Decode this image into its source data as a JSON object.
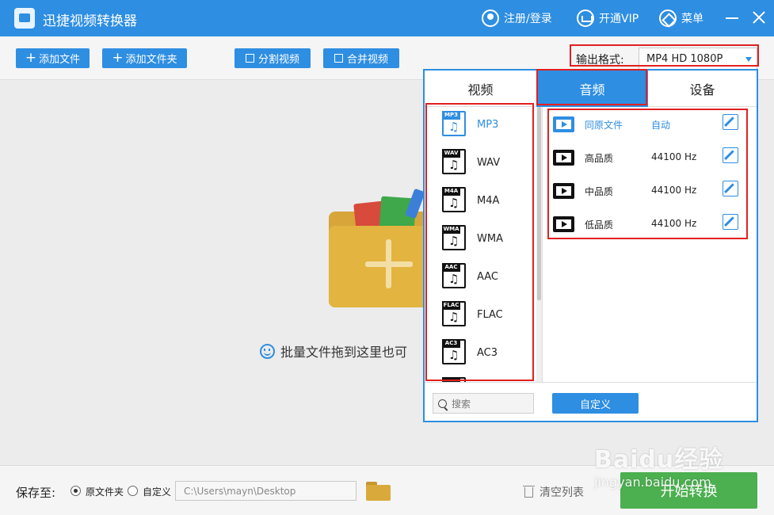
{
  "app": {
    "title": "迅捷视频转换器"
  },
  "titlebar": {
    "login": "注册/登录",
    "vip": "开通VIP",
    "menu": "菜单"
  },
  "toolbar": {
    "add_file": "添加文件",
    "add_folder": "添加文件夹",
    "split_video": "分割视频",
    "merge_video": "合并视频",
    "output_label": "输出格式:",
    "output_value": "MP4  HD 1080P"
  },
  "main": {
    "hint": "批量文件拖到这里也可"
  },
  "footer": {
    "save_label": "保存至:",
    "radio_original": "原文件夹",
    "radio_custom": "自定义",
    "path": "C:\\Users\\mayn\\Desktop",
    "clear_list": "清空列表",
    "start": "开始转换"
  },
  "format_panel": {
    "tabs": [
      {
        "label": "视频",
        "active": false
      },
      {
        "label": "音频",
        "active": true
      },
      {
        "label": "设备",
        "active": false
      }
    ],
    "formats": [
      {
        "tag": "MP3",
        "label": "MP3",
        "selected": true
      },
      {
        "tag": "WAV",
        "label": "WAV",
        "selected": false
      },
      {
        "tag": "M4A",
        "label": "M4A",
        "selected": false
      },
      {
        "tag": "WMA",
        "label": "WMA",
        "selected": false
      },
      {
        "tag": "AAC",
        "label": "AAC",
        "selected": false
      },
      {
        "tag": "FLAC",
        "label": "FLAC",
        "selected": false
      },
      {
        "tag": "AC3",
        "label": "AC3",
        "selected": false
      }
    ],
    "qualities": [
      {
        "name": "同原文件",
        "value": "自动"
      },
      {
        "name": "高品质",
        "value": "44100 Hz"
      },
      {
        "name": "中品质",
        "value": "44100 Hz"
      },
      {
        "name": "低品质",
        "value": "44100 Hz"
      }
    ],
    "search_placeholder": "搜索",
    "custom_button": "自定义"
  },
  "colors": {
    "accent": "#2e8ee2",
    "start_button": "#4caf50",
    "highlight_box": "#e02020",
    "folder": "#e3b440"
  },
  "icons": {
    "logo": "app-logo-icon",
    "login": "user-icon",
    "vip": "cart-icon",
    "menu": "layers-icon",
    "format_file": "music-file-icon",
    "quality": "film-icon",
    "edit": "edit-icon",
    "search": "search-icon",
    "trash": "trash-icon",
    "browse": "folder-icon"
  },
  "watermark": {
    "main": "Baidu经验",
    "sub": "jingyan.baidu.com"
  }
}
